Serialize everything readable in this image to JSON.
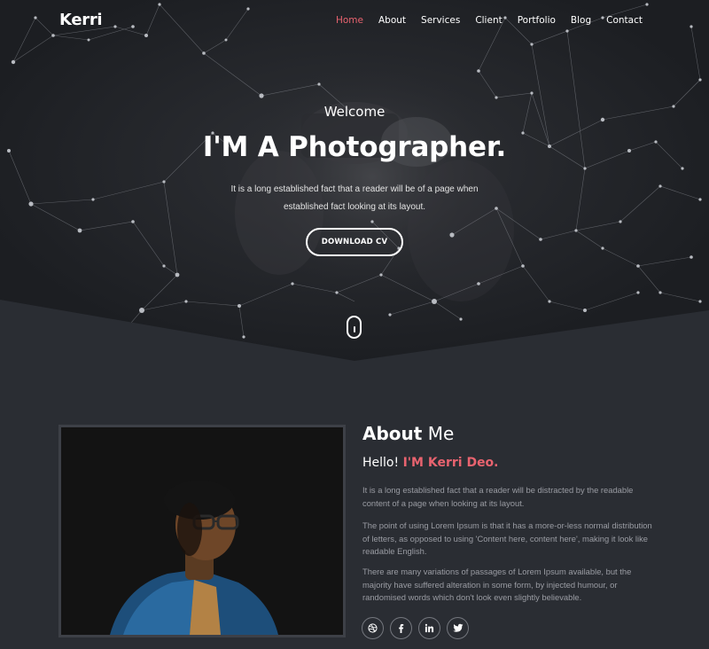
{
  "brand": "Kerri",
  "nav": {
    "items": [
      {
        "label": "Home",
        "active": true
      },
      {
        "label": "About",
        "active": false
      },
      {
        "label": "Services",
        "active": false
      },
      {
        "label": "Client",
        "active": false
      },
      {
        "label": "Portfolio",
        "active": false
      },
      {
        "label": "Blog",
        "active": false
      },
      {
        "label": "Contact",
        "active": false
      }
    ]
  },
  "hero": {
    "welcome": "Welcome",
    "headline": "I'M A Photographer.",
    "intro": "It is a long established fact that a reader will be of a page when established fact looking at its layout.",
    "cta_label": "DOWNLOAD CV"
  },
  "about": {
    "title_bold": "About",
    "title_light": "Me",
    "hello_prefix": "Hello!",
    "hello_name": "I'M Kerri Deo.",
    "paragraphs": [
      "It is a long established fact that a reader will be distracted by the readable content of a page when looking at its layout.",
      "The point of using Lorem Ipsum is that it has a more-or-less normal distribution of letters, as opposed to using 'Content here, content here', making it look like readable English.",
      "There are many variations of passages of Lorem Ipsum available, but the majority have suffered alteration in some form, by injected humour, or randomised words which don't look even slightly believable."
    ],
    "socials": [
      "dribbble-icon",
      "facebook-icon",
      "linkedin-icon",
      "twitter-icon"
    ]
  },
  "colors": {
    "accent": "#e8636f",
    "hero_bg": "#1d1f23",
    "page_bg": "#2a2d33",
    "muted_text": "#9a9ca3"
  }
}
